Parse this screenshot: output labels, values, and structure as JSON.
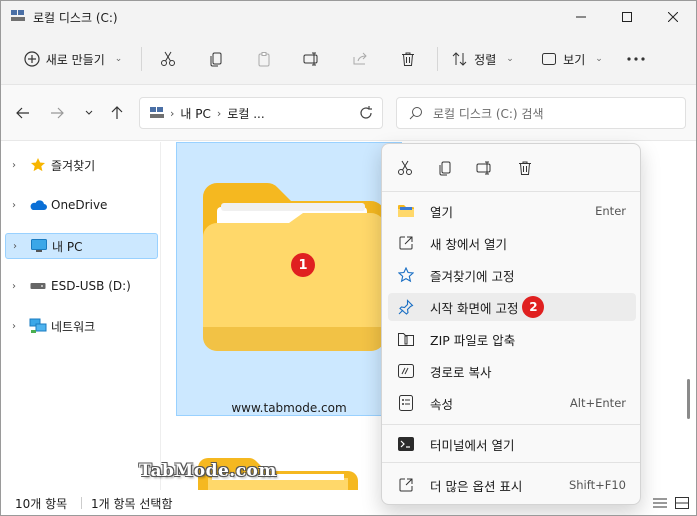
{
  "window": {
    "title": "로컬 디스크 (C:)"
  },
  "toolbar": {
    "new_label": "새로 만들기",
    "sort_label": "정렬",
    "view_label": "보기"
  },
  "address": {
    "root": "내 PC",
    "current": "로컬 ..."
  },
  "search": {
    "placeholder": "로컬 디스크 (C:) 검색"
  },
  "sidebar": {
    "items": [
      {
        "label": "즐겨찾기",
        "icon": "star-icon"
      },
      {
        "label": "OneDrive",
        "icon": "cloud-icon"
      },
      {
        "label": "내 PC",
        "icon": "monitor-icon",
        "selected": true
      },
      {
        "label": "ESD-USB (D:)",
        "icon": "drive-icon"
      },
      {
        "label": "네트워크",
        "icon": "network-icon"
      }
    ]
  },
  "content": {
    "tile_label": "www.tabmode.com",
    "badge1": "1"
  },
  "context_menu": {
    "items": [
      {
        "label": "열기",
        "shortcut": "Enter"
      },
      {
        "label": "새 창에서 열기",
        "shortcut": ""
      },
      {
        "label": "즐겨찾기에 고정",
        "shortcut": ""
      },
      {
        "label": "시작 화면에 고정",
        "shortcut": "",
        "badge": "2"
      },
      {
        "label": "ZIP 파일로 압축",
        "shortcut": ""
      },
      {
        "label": "경로로 복사",
        "shortcut": ""
      },
      {
        "label": "속성",
        "shortcut": "Alt+Enter"
      },
      {
        "label": "터미널에서 열기",
        "shortcut": ""
      },
      {
        "label": "더 많은 옵션 표시",
        "shortcut": "Shift+F10"
      }
    ]
  },
  "status": {
    "count": "10개 항목",
    "selected": "1개 항목 선택함"
  },
  "watermark": "TabMode.com",
  "colors": {
    "accent": "#0067c0",
    "selection": "#cce8ff",
    "folder": "#ffc83d",
    "badge": "#e02020"
  }
}
